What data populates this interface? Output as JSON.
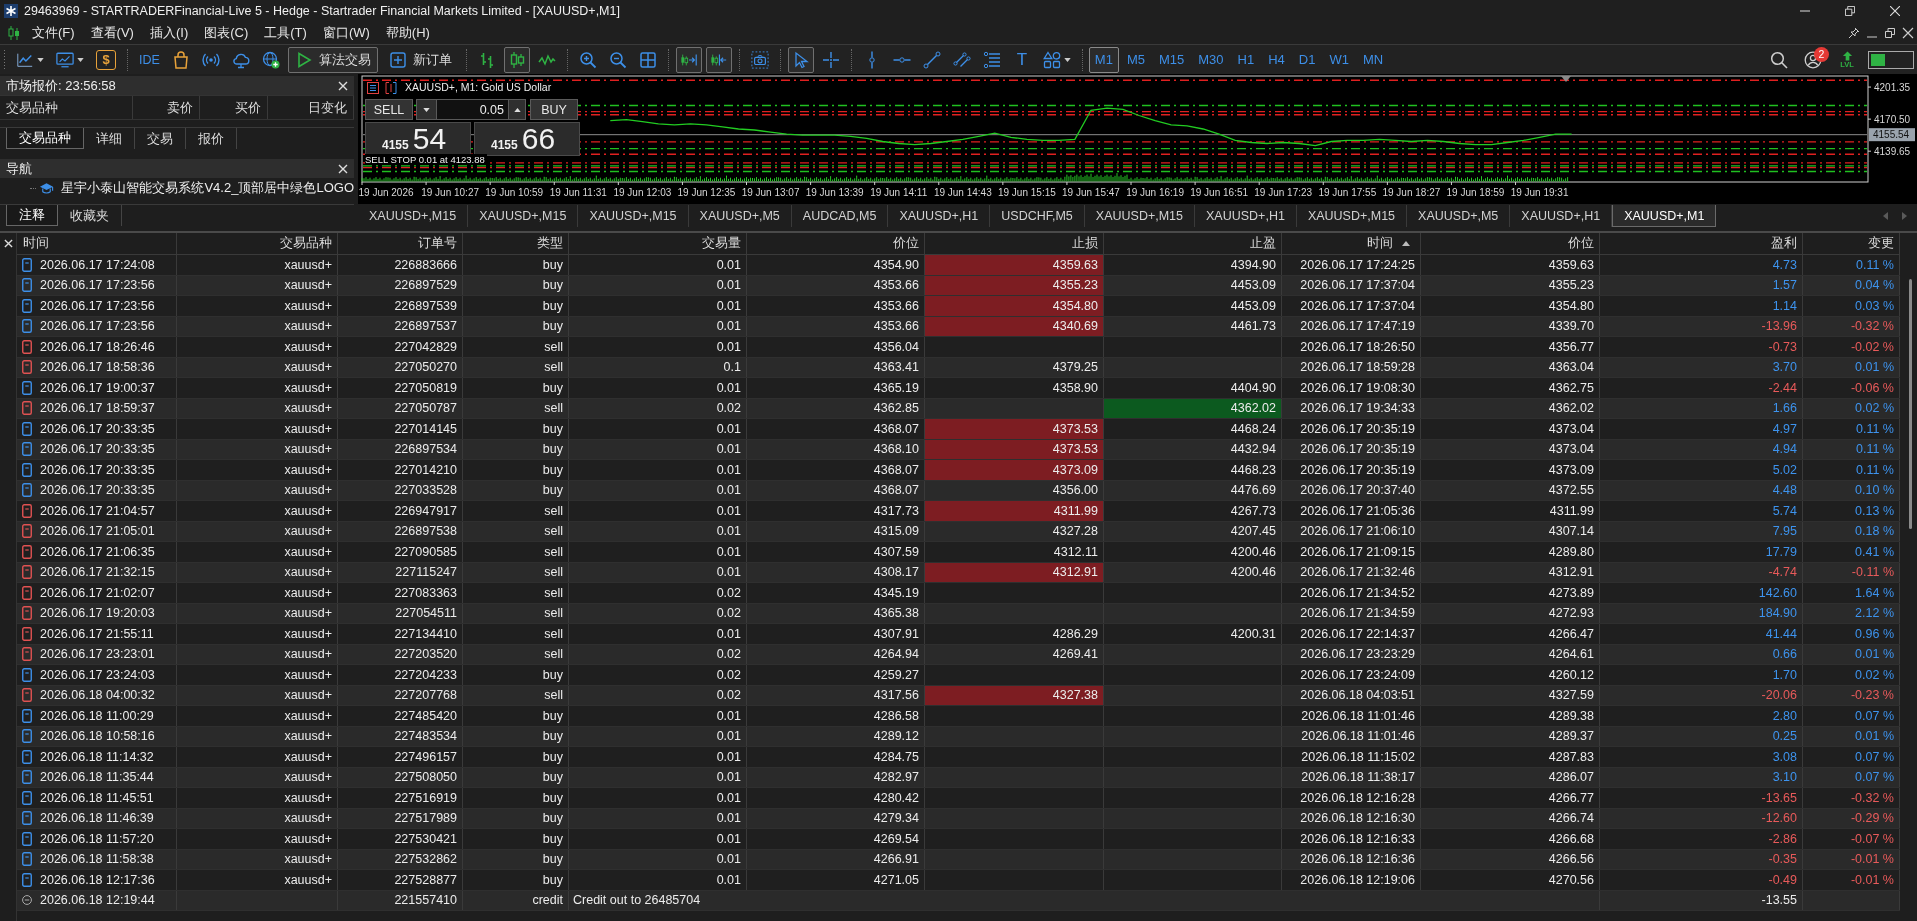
{
  "window": {
    "title": "29463969 - STARTRADERFinancial-Live 5 - Hedge - Startrader Financial Markets Limited - [XAUUSD+,M1]"
  },
  "menu": [
    "文件(F)",
    "查看(V)",
    "插入(I)",
    "图表(C)",
    "工具(T)",
    "窗口(W)",
    "帮助(H)"
  ],
  "toolbar": {
    "market_symbol": "$",
    "ide_label": "IDE",
    "algo_trading": {
      "label": "算法交易",
      "on": true
    },
    "new_order": "新订单",
    "chart_types": [
      {
        "kind": "bars",
        "selected": false
      },
      {
        "kind": "candles",
        "selected": true
      },
      {
        "kind": "line",
        "selected": false
      }
    ],
    "toggles": [
      {
        "kind": "autoscroll",
        "on": true
      },
      {
        "kind": "chart_shift",
        "on": true
      }
    ],
    "tools": [
      {
        "kind": "cursor",
        "selected": true
      },
      {
        "kind": "crosshair",
        "selected": false
      }
    ],
    "text_tool": "T",
    "timeframes": [
      {
        "label": "M1",
        "selected": true
      },
      {
        "label": "M5",
        "selected": false
      },
      {
        "label": "M15",
        "selected": false
      },
      {
        "label": "M30",
        "selected": false
      },
      {
        "label": "H1",
        "selected": false
      },
      {
        "label": "H4",
        "selected": false
      },
      {
        "label": "D1",
        "selected": false
      },
      {
        "label": "W1",
        "selected": false
      },
      {
        "label": "MN",
        "selected": false
      }
    ],
    "notifications": "2",
    "lvl_label": "LVL"
  },
  "market_watch": {
    "title": "市场报价: 23:56:58",
    "columns": [
      "交易品种",
      "卖价",
      "买价",
      "日变化"
    ],
    "tabs": [
      {
        "label": "交易品种",
        "selected": true
      },
      {
        "label": "详细",
        "selected": false
      },
      {
        "label": "交易",
        "selected": false
      },
      {
        "label": "报价",
        "selected": false
      }
    ]
  },
  "navigator": {
    "title": "导航",
    "items": [
      {
        "label": "星宇小泰山智能交易系统V4.2_顶部居中绿色LOGO"
      }
    ],
    "tabs": [
      {
        "label": "注释",
        "selected": true
      },
      {
        "label": "收藏夹",
        "selected": false
      }
    ]
  },
  "chart": {
    "title": "XAUUSD+, M1: Gold US Dollar",
    "trade_panel": {
      "sell": "SELL",
      "buy": "BUY",
      "volume": "0.05",
      "bid_prefix": "4155",
      "bid_main": "54",
      "ask_prefix": "4155",
      "ask_main": "66"
    },
    "pending_order_label": "SELL STOP 0.01 at 4123.88",
    "chart_data": {
      "type": "line",
      "categories": [
        null,
        "19 Jun 2026",
        null,
        null,
        null,
        "19 Jun 10:27",
        null,
        null,
        null,
        "19 Jun 10:59",
        null,
        null,
        null,
        "19 Jun 11:31",
        null,
        null,
        null,
        "19 Jun 12:03",
        null,
        null,
        null,
        "19 Jun 12:35",
        null,
        null,
        null,
        "19 Jun 13:07",
        null,
        null,
        null,
        "19 Jun 13:39",
        null,
        null,
        null,
        "19 Jun 14:11",
        null,
        null,
        null,
        "19 Jun 14:43",
        null,
        null,
        null,
        "19 Jun 15:15",
        null,
        null,
        null,
        "19 Jun 15:47",
        null,
        null,
        null,
        "19 Jun 16:19",
        null,
        null,
        null,
        "19 Jun 16:51",
        null,
        null,
        null,
        "19 Jun 17:23",
        null,
        null,
        null,
        "19 Jun 17:55",
        null,
        null,
        null,
        "19 Jun 18:27",
        null,
        null,
        null,
        "19 Jun 18:59",
        null,
        null,
        null,
        "19 Jun 19:31",
        null,
        null,
        null,
        null,
        null,
        null,
        null,
        null,
        null,
        null,
        null,
        null,
        null,
        null,
        null,
        null,
        null,
        null,
        null,
        null
      ],
      "series": [
        {
          "color": "#22cc22",
          "values": [
            null,
            null,
            null,
            null,
            null,
            null,
            null,
            null,
            null,
            null,
            null,
            null,
            null,
            null,
            null,
            4169,
            4170,
            4168,
            4166,
            4165,
            4166,
            4165,
            4163,
            4161,
            4160,
            4158,
            4156,
            4155,
            4155,
            4155,
            4154,
            4152,
            4149,
            4147,
            4146,
            4147,
            4149,
            4151,
            4154,
            4157,
            4153,
            4151,
            4150,
            4150,
            4151,
            4179,
            4181,
            4180,
            4174,
            4169,
            4165,
            4164,
            4161,
            4156,
            4150,
            4148,
            4147,
            4148,
            4147,
            4145,
            4149,
            4150,
            4150,
            4151,
            4150,
            4149,
            4150,
            4149,
            4147,
            4146,
            4146,
            4148,
            4150,
            4153,
            4156,
            4156,
            null,
            null,
            null,
            null,
            null,
            null,
            null,
            null,
            null,
            null,
            null,
            null,
            null,
            null,
            null,
            null,
            null,
            null
          ]
        }
      ],
      "ylim": [
        4110,
        4212
      ],
      "yticks": [
        {
          "value": 4201.35,
          "label": "4201.35"
        },
        {
          "value": 4170.5,
          "label": "4170.50"
        },
        {
          "value": 4139.65,
          "label": "4139.65"
        }
      ],
      "ref_lines": [
        {
          "axis": "y",
          "value": 4207.9,
          "color": "#e02020"
        },
        {
          "axis": "y",
          "value": 4183.6,
          "color": "#20c020"
        },
        {
          "axis": "y",
          "value": 4177.7,
          "color": "#e02020"
        },
        {
          "axis": "y",
          "value": 4174.7,
          "color": "#e02020"
        },
        {
          "axis": "y",
          "value": 4155.54,
          "color": "#8c8c8c",
          "label": "4155.54"
        },
        {
          "axis": "y",
          "value": 4148.6,
          "color": "#e02020"
        },
        {
          "axis": "y",
          "value": 4142.1,
          "color": "#20c020"
        },
        {
          "axis": "y",
          "value": 4136.7,
          "color": "#e02020"
        },
        {
          "axis": "y",
          "value": 4128.4,
          "color": "#e02020"
        },
        {
          "axis": "y",
          "value": 4125.5,
          "color": "#20c020"
        },
        {
          "axis": "y",
          "value": 4123.88,
          "color": "#e02020"
        },
        {
          "axis": "y",
          "value": 4120.1,
          "color": "#20c020"
        }
      ]
    }
  },
  "chart_tabs": [
    {
      "label": "XAUUSD+,M15",
      "selected": false
    },
    {
      "label": "XAUUSD+,M15",
      "selected": false
    },
    {
      "label": "XAUUSD+,M15",
      "selected": false
    },
    {
      "label": "XAUUSD+,M5",
      "selected": false
    },
    {
      "label": "AUDCAD,M5",
      "selected": false
    },
    {
      "label": "XAUUSD+,H1",
      "selected": false
    },
    {
      "label": "USDCHF,M5",
      "selected": false
    },
    {
      "label": "XAUUSD+,M15",
      "selected": false
    },
    {
      "label": "XAUUSD+,H1",
      "selected": false
    },
    {
      "label": "XAUUSD+,M15",
      "selected": false
    },
    {
      "label": "XAUUSD+,M5",
      "selected": false
    },
    {
      "label": "XAUUSD+,H1",
      "selected": false
    },
    {
      "label": "XAUUSD+,M1",
      "selected": true
    }
  ],
  "table": {
    "columns": [
      {
        "label": "时间",
        "sorted": false
      },
      {
        "label": "交易品种",
        "sorted": false
      },
      {
        "label": "订单号",
        "sorted": false
      },
      {
        "label": "类型",
        "sorted": false
      },
      {
        "label": "交易量",
        "sorted": false
      },
      {
        "label": "价位",
        "sorted": false
      },
      {
        "label": "止损",
        "sorted": false
      },
      {
        "label": "止盈",
        "sorted": false
      },
      {
        "label": "时间",
        "sorted": true
      },
      {
        "label": "价位",
        "sorted": false
      },
      {
        "label": "盈利",
        "sorted": false
      },
      {
        "label": "变更",
        "sorted": false
      }
    ],
    "rows": [
      {
        "kind": "buy",
        "open_time": "2026.06.17 17:24:08",
        "symbol": "xauusd+",
        "ticket": "226883666",
        "type": "buy",
        "volume": "0.01",
        "open_price": "4354.90",
        "sl": "4359.63",
        "sl_hit": true,
        "tp": "4394.90",
        "tp_hit": false,
        "close_time": "2026.06.17 17:24:25",
        "close_price": "4359.63",
        "profit": "4.73",
        "change": "0.11 %",
        "loss": false
      },
      {
        "kind": "buy",
        "open_time": "2026.06.17 17:23:56",
        "symbol": "xauusd+",
        "ticket": "226897529",
        "type": "buy",
        "volume": "0.01",
        "open_price": "4353.66",
        "sl": "4355.23",
        "sl_hit": true,
        "tp": "4453.09",
        "tp_hit": false,
        "close_time": "2026.06.17 17:37:04",
        "close_price": "4355.23",
        "profit": "1.57",
        "change": "0.04 %",
        "loss": false
      },
      {
        "kind": "buy",
        "open_time": "2026.06.17 17:23:56",
        "symbol": "xauusd+",
        "ticket": "226897539",
        "type": "buy",
        "volume": "0.01",
        "open_price": "4353.66",
        "sl": "4354.80",
        "sl_hit": true,
        "tp": "4453.09",
        "tp_hit": false,
        "close_time": "2026.06.17 17:37:04",
        "close_price": "4354.80",
        "profit": "1.14",
        "change": "0.03 %",
        "loss": false
      },
      {
        "kind": "buy",
        "open_time": "2026.06.17 17:23:56",
        "symbol": "xauusd+",
        "ticket": "226897537",
        "type": "buy",
        "volume": "0.01",
        "open_price": "4353.66",
        "sl": "4340.69",
        "sl_hit": true,
        "tp": "4461.73",
        "tp_hit": false,
        "close_time": "2026.06.17 17:47:19",
        "close_price": "4339.70",
        "profit": "-13.96",
        "change": "-0.32 %",
        "loss": true
      },
      {
        "kind": "sell",
        "open_time": "2026.06.17 18:26:46",
        "symbol": "xauusd+",
        "ticket": "227042829",
        "type": "sell",
        "volume": "0.01",
        "open_price": "4356.04",
        "sl_hit": false,
        "tp_hit": false,
        "close_time": "2026.06.17 18:26:50",
        "close_price": "4356.77",
        "profit": "-0.73",
        "change": "-0.02 %",
        "loss": true
      },
      {
        "kind": "sell",
        "open_time": "2026.06.17 18:58:36",
        "symbol": "xauusd+",
        "ticket": "227050270",
        "type": "sell",
        "volume": "0.1",
        "open_price": "4363.41",
        "sl": "4379.25",
        "sl_hit": false,
        "tp_hit": false,
        "close_time": "2026.06.17 18:59:28",
        "close_price": "4363.04",
        "profit": "3.70",
        "change": "0.01 %",
        "loss": false
      },
      {
        "kind": "buy",
        "open_time": "2026.06.17 19:00:37",
        "symbol": "xauusd+",
        "ticket": "227050819",
        "type": "buy",
        "volume": "0.01",
        "open_price": "4365.19",
        "sl": "4358.90",
        "sl_hit": false,
        "tp": "4404.90",
        "tp_hit": false,
        "close_time": "2026.06.17 19:08:30",
        "close_price": "4362.75",
        "profit": "-2.44",
        "change": "-0.06 %",
        "loss": true
      },
      {
        "kind": "sell",
        "open_time": "2026.06.17 18:59:37",
        "symbol": "xauusd+",
        "ticket": "227050787",
        "type": "sell",
        "volume": "0.02",
        "open_price": "4362.85",
        "sl_hit": false,
        "tp": "4362.02",
        "tp_hit": true,
        "close_time": "2026.06.17 19:34:33",
        "close_price": "4362.02",
        "profit": "1.66",
        "change": "0.02 %",
        "loss": false
      },
      {
        "kind": "buy",
        "open_time": "2026.06.17 20:33:35",
        "symbol": "xauusd+",
        "ticket": "227014145",
        "type": "buy",
        "volume": "0.01",
        "open_price": "4368.07",
        "sl": "4373.53",
        "sl_hit": true,
        "tp": "4468.24",
        "tp_hit": false,
        "close_time": "2026.06.17 20:35:19",
        "close_price": "4373.04",
        "profit": "4.97",
        "change": "0.11 %",
        "loss": false
      },
      {
        "kind": "buy",
        "open_time": "2026.06.17 20:33:35",
        "symbol": "xauusd+",
        "ticket": "226897534",
        "type": "buy",
        "volume": "0.01",
        "open_price": "4368.10",
        "sl": "4373.53",
        "sl_hit": true,
        "tp": "4432.94",
        "tp_hit": false,
        "close_time": "2026.06.17 20:35:19",
        "close_price": "4373.04",
        "profit": "4.94",
        "change": "0.11 %",
        "loss": false
      },
      {
        "kind": "buy",
        "open_time": "2026.06.17 20:33:35",
        "symbol": "xauusd+",
        "ticket": "227014210",
        "type": "buy",
        "volume": "0.01",
        "open_price": "4368.07",
        "sl": "4373.09",
        "sl_hit": true,
        "tp": "4468.23",
        "tp_hit": false,
        "close_time": "2026.06.17 20:35:19",
        "close_price": "4373.09",
        "profit": "5.02",
        "change": "0.11 %",
        "loss": false
      },
      {
        "kind": "buy",
        "open_time": "2026.06.17 20:33:35",
        "symbol": "xauusd+",
        "ticket": "227033528",
        "type": "buy",
        "volume": "0.01",
        "open_price": "4368.07",
        "sl": "4356.00",
        "sl_hit": false,
        "tp": "4476.69",
        "tp_hit": false,
        "close_time": "2026.06.17 20:37:40",
        "close_price": "4372.55",
        "profit": "4.48",
        "change": "0.10 %",
        "loss": false
      },
      {
        "kind": "sell",
        "open_time": "2026.06.17 21:04:57",
        "symbol": "xauusd+",
        "ticket": "226947917",
        "type": "sell",
        "volume": "0.01",
        "open_price": "4317.73",
        "sl": "4311.99",
        "sl_hit": true,
        "tp": "4267.73",
        "tp_hit": false,
        "close_time": "2026.06.17 21:05:36",
        "close_price": "4311.99",
        "profit": "5.74",
        "change": "0.13 %",
        "loss": false
      },
      {
        "kind": "sell",
        "open_time": "2026.06.17 21:05:01",
        "symbol": "xauusd+",
        "ticket": "226897538",
        "type": "sell",
        "volume": "0.01",
        "open_price": "4315.09",
        "sl": "4327.28",
        "sl_hit": false,
        "tp": "4207.45",
        "tp_hit": false,
        "close_time": "2026.06.17 21:06:10",
        "close_price": "4307.14",
        "profit": "7.95",
        "change": "0.18 %",
        "loss": false
      },
      {
        "kind": "sell",
        "open_time": "2026.06.17 21:06:35",
        "symbol": "xauusd+",
        "ticket": "227090585",
        "type": "sell",
        "volume": "0.01",
        "open_price": "4307.59",
        "sl": "4312.11",
        "sl_hit": false,
        "tp": "4200.46",
        "tp_hit": false,
        "close_time": "2026.06.17 21:09:15",
        "close_price": "4289.80",
        "profit": "17.79",
        "change": "0.41 %",
        "loss": false
      },
      {
        "kind": "sell",
        "open_time": "2026.06.17 21:32:15",
        "symbol": "xauusd+",
        "ticket": "227115247",
        "type": "sell",
        "volume": "0.01",
        "open_price": "4308.17",
        "sl": "4312.91",
        "sl_hit": true,
        "tp": "4200.46",
        "tp_hit": false,
        "close_time": "2026.06.17 21:32:46",
        "close_price": "4312.91",
        "profit": "-4.74",
        "change": "-0.11 %",
        "loss": true
      },
      {
        "kind": "sell",
        "open_time": "2026.06.17 21:02:07",
        "symbol": "xauusd+",
        "ticket": "227083363",
        "type": "sell",
        "volume": "0.02",
        "open_price": "4345.19",
        "sl_hit": false,
        "tp_hit": false,
        "close_time": "2026.06.17 21:34:52",
        "close_price": "4273.89",
        "profit": "142.60",
        "change": "1.64 %",
        "loss": false
      },
      {
        "kind": "sell",
        "open_time": "2026.06.17 19:20:03",
        "symbol": "xauusd+",
        "ticket": "227054511",
        "type": "sell",
        "volume": "0.02",
        "open_price": "4365.38",
        "sl_hit": false,
        "tp_hit": false,
        "close_time": "2026.06.17 21:34:59",
        "close_price": "4272.93",
        "profit": "184.90",
        "change": "2.12 %",
        "loss": false
      },
      {
        "kind": "sell",
        "open_time": "2026.06.17 21:55:11",
        "symbol": "xauusd+",
        "ticket": "227134410",
        "type": "sell",
        "volume": "0.01",
        "open_price": "4307.91",
        "sl": "4286.29",
        "sl_hit": false,
        "tp": "4200.31",
        "tp_hit": false,
        "close_time": "2026.06.17 22:14:37",
        "close_price": "4266.47",
        "profit": "41.44",
        "change": "0.96 %",
        "loss": false
      },
      {
        "kind": "sell",
        "open_time": "2026.06.17 23:23:01",
        "symbol": "xauusd+",
        "ticket": "227203520",
        "type": "sell",
        "volume": "0.02",
        "open_price": "4264.94",
        "sl": "4269.41",
        "sl_hit": false,
        "tp_hit": false,
        "close_time": "2026.06.17 23:23:29",
        "close_price": "4264.61",
        "profit": "0.66",
        "change": "0.01 %",
        "loss": false
      },
      {
        "kind": "buy",
        "open_time": "2026.06.17 23:24:03",
        "symbol": "xauusd+",
        "ticket": "227204233",
        "type": "buy",
        "volume": "0.02",
        "open_price": "4259.27",
        "sl_hit": false,
        "tp_hit": false,
        "close_time": "2026.06.17 23:24:09",
        "close_price": "4260.12",
        "profit": "1.70",
        "change": "0.02 %",
        "loss": false
      },
      {
        "kind": "sell",
        "open_time": "2026.06.18 04:00:32",
        "symbol": "xauusd+",
        "ticket": "227207768",
        "type": "sell",
        "volume": "0.02",
        "open_price": "4317.56",
        "sl": "4327.38",
        "sl_hit": true,
        "tp_hit": false,
        "close_time": "2026.06.18 04:03:51",
        "close_price": "4327.59",
        "profit": "-20.06",
        "change": "-0.23 %",
        "loss": true
      },
      {
        "kind": "buy",
        "open_time": "2026.06.18 11:00:29",
        "symbol": "xauusd+",
        "ticket": "227485420",
        "type": "buy",
        "volume": "0.01",
        "open_price": "4286.58",
        "sl_hit": false,
        "tp_hit": false,
        "close_time": "2026.06.18 11:01:46",
        "close_price": "4289.38",
        "profit": "2.80",
        "change": "0.07 %",
        "loss": false
      },
      {
        "kind": "buy",
        "open_time": "2026.06.18 10:58:16",
        "symbol": "xauusd+",
        "ticket": "227483534",
        "type": "buy",
        "volume": "0.01",
        "open_price": "4289.12",
        "sl_hit": false,
        "tp_hit": false,
        "close_time": "2026.06.18 11:01:46",
        "close_price": "4289.37",
        "profit": "0.25",
        "change": "0.01 %",
        "loss": false
      },
      {
        "kind": "buy",
        "open_time": "2026.06.18 11:14:32",
        "symbol": "xauusd+",
        "ticket": "227496157",
        "type": "buy",
        "volume": "0.01",
        "open_price": "4284.75",
        "sl_hit": false,
        "tp_hit": false,
        "close_time": "2026.06.18 11:15:02",
        "close_price": "4287.83",
        "profit": "3.08",
        "change": "0.07 %",
        "loss": false
      },
      {
        "kind": "buy",
        "open_time": "2026.06.18 11:35:44",
        "symbol": "xauusd+",
        "ticket": "227508050",
        "type": "buy",
        "volume": "0.01",
        "open_price": "4282.97",
        "sl_hit": false,
        "tp_hit": false,
        "close_time": "2026.06.18 11:38:17",
        "close_price": "4286.07",
        "profit": "3.10",
        "change": "0.07 %",
        "loss": false
      },
      {
        "kind": "buy",
        "open_time": "2026.06.18 11:45:51",
        "symbol": "xauusd+",
        "ticket": "227516919",
        "type": "buy",
        "volume": "0.01",
        "open_price": "4280.42",
        "sl_hit": false,
        "tp_hit": false,
        "close_time": "2026.06.18 12:16:28",
        "close_price": "4266.77",
        "profit": "-13.65",
        "change": "-0.32 %",
        "loss": true
      },
      {
        "kind": "buy",
        "open_time": "2026.06.18 11:46:39",
        "symbol": "xauusd+",
        "ticket": "227517989",
        "type": "buy",
        "volume": "0.01",
        "open_price": "4279.34",
        "sl_hit": false,
        "tp_hit": false,
        "close_time": "2026.06.18 12:16:30",
        "close_price": "4266.74",
        "profit": "-12.60",
        "change": "-0.29 %",
        "loss": true
      },
      {
        "kind": "buy",
        "open_time": "2026.06.18 11:57:20",
        "symbol": "xauusd+",
        "ticket": "227530421",
        "type": "buy",
        "volume": "0.01",
        "open_price": "4269.54",
        "sl_hit": false,
        "tp_hit": false,
        "close_time": "2026.06.18 12:16:33",
        "close_price": "4266.68",
        "profit": "-2.86",
        "change": "-0.07 %",
        "loss": true
      },
      {
        "kind": "buy",
        "open_time": "2026.06.18 11:58:38",
        "symbol": "xauusd+",
        "ticket": "227532862",
        "type": "buy",
        "volume": "0.01",
        "open_price": "4266.91",
        "sl_hit": false,
        "tp_hit": false,
        "close_time": "2026.06.18 12:16:36",
        "close_price": "4266.56",
        "profit": "-0.35",
        "change": "-0.01 %",
        "loss": true
      },
      {
        "kind": "buy",
        "open_time": "2026.06.18 12:17:36",
        "symbol": "xauusd+",
        "ticket": "227528877",
        "type": "buy",
        "volume": "0.01",
        "open_price": "4271.05",
        "sl_hit": false,
        "tp_hit": false,
        "close_time": "2026.06.18 12:19:06",
        "close_price": "4270.56",
        "profit": "-0.49",
        "change": "-0.01 %",
        "loss": true
      }
    ],
    "credit_row": {
      "time": "2026.06.18 12:19:44",
      "ticket": "221557410",
      "type": "credit",
      "comment": "Credit out to 26485704",
      "profit": "-13.55"
    }
  }
}
